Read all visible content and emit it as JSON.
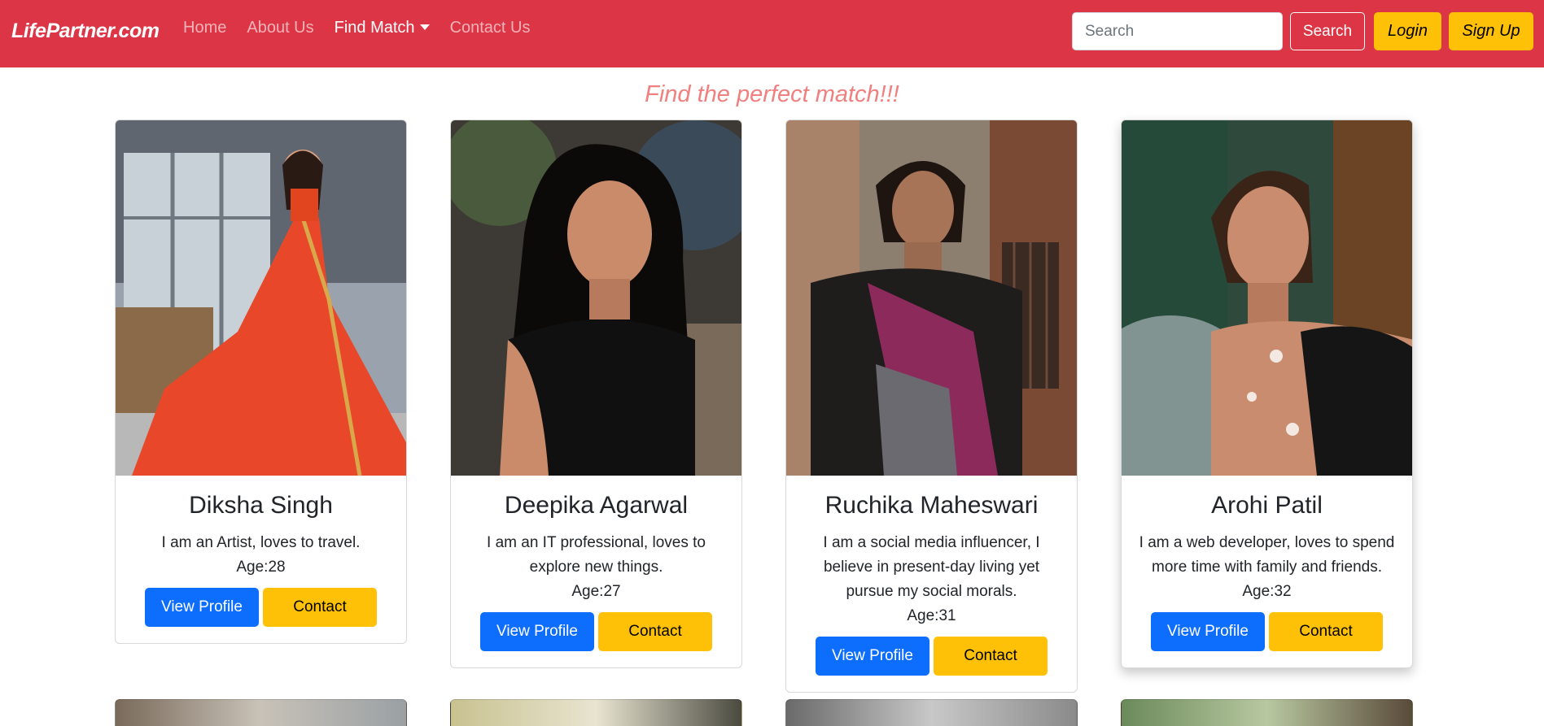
{
  "navbar": {
    "brand": "LifePartner.com",
    "links": [
      "Home",
      "About Us",
      "Find Match",
      "Contact Us"
    ],
    "search_placeholder": "Search",
    "search_button": "Search",
    "login_button": "Login",
    "signup_button": "Sign Up",
    "color": "#dc3545"
  },
  "headline": "Find the perfect match!!!",
  "cards": [
    {
      "name": "Diksha Singh",
      "description": "I am an Artist, loves to travel.",
      "age": "Age:28",
      "view_label": "View Profile",
      "contact_label": "Contact"
    },
    {
      "name": "Deepika Agarwal",
      "description": "I am an IT professional, loves to explore new things.",
      "age": "Age:27",
      "view_label": "View Profile",
      "contact_label": "Contact"
    },
    {
      "name": "Ruchika Maheswari",
      "description": "I am a social media influencer, I believe in present-day living yet pursue my social morals.",
      "age": "Age:31",
      "view_label": "View Profile",
      "contact_label": "Contact"
    },
    {
      "name": "Arohi Patil",
      "description": "I am a web developer, loves to spend more time with family and friends.",
      "age": "Age:32",
      "view_label": "View Profile",
      "contact_label": "Contact"
    }
  ],
  "colors": {
    "primary": "#0d6efd",
    "warning": "#ffc107",
    "danger": "#dc3545",
    "headline": "#f08080"
  }
}
